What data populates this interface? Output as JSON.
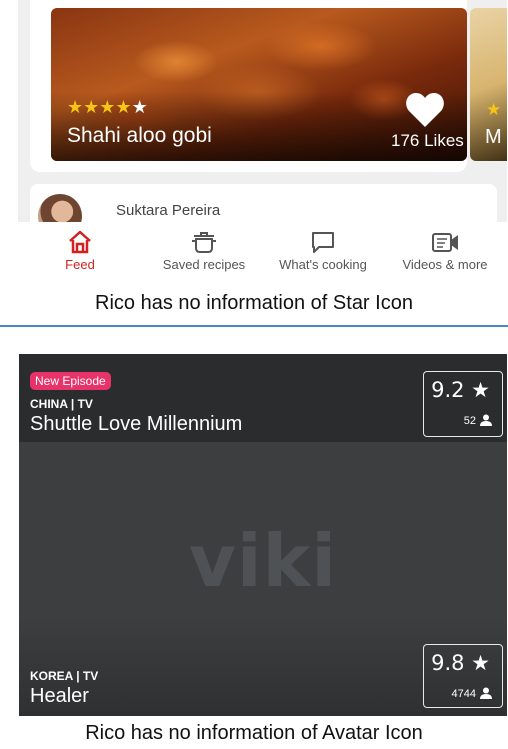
{
  "top_panel": {
    "recipe_card": {
      "rating_stars": 4,
      "max_stars": 5,
      "title": "Shahi aloo gobi",
      "likes_label": "176 Likes",
      "heart_icon": "heart-icon",
      "side_card_letter": "M"
    },
    "author_card": {
      "name": "Suktara Pereira"
    },
    "tabs": [
      {
        "label": "Feed",
        "icon": "home-icon",
        "active": true
      },
      {
        "label": "Saved recipes",
        "icon": "pot-icon",
        "active": false
      },
      {
        "label": "What's cooking",
        "icon": "chat-bubble-icon",
        "active": false
      },
      {
        "label": "Videos & more",
        "icon": "video-icon",
        "active": false
      }
    ],
    "caption": "Rico has no information of Star Icon"
  },
  "bottom_panel": {
    "shows": [
      {
        "badge": "New Episode",
        "country": "CHINA | TV",
        "title": "Shuttle Love Millennium",
        "score": "9.2 ★",
        "count": "52"
      },
      {
        "country": "KOREA | TV",
        "title": "Healer",
        "score": "9.8 ★",
        "count": "4744"
      }
    ],
    "logo_text": "viki",
    "caption": "Rico has no information of Avatar Icon"
  },
  "colors": {
    "accent_red": "#d42020",
    "badge_pink": "#e8336a",
    "star_gold": "#f5c518",
    "divider_blue": "#4a86c8"
  }
}
